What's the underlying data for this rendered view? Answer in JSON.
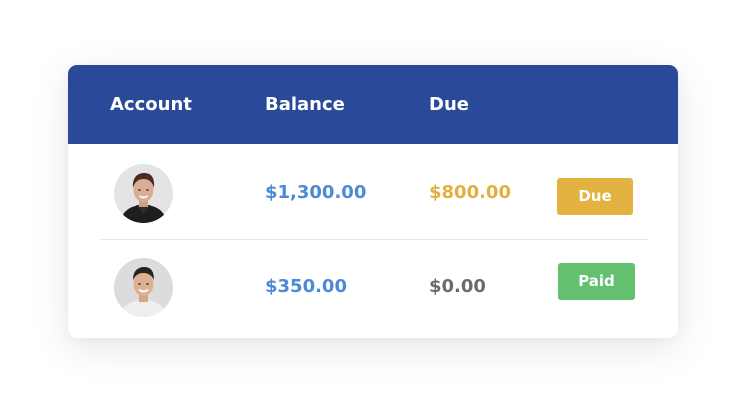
{
  "table": {
    "columns": {
      "account": "Account",
      "balance": "Balance",
      "due": "Due"
    },
    "rows": [
      {
        "balance": "$1,300.00",
        "due": "$800.00",
        "due_color": "#e3b040",
        "status": "Due",
        "status_color": "#e3b240"
      },
      {
        "balance": "$350.00",
        "due": "$0.00",
        "due_color": "#6b6b6b",
        "status": "Paid",
        "status_color": "#62c06f"
      }
    ]
  },
  "colors": {
    "header": "#2a4a99",
    "balance": "#4a8ad6"
  },
  "icons": {
    "row_avatar": "user-photo-avatar"
  }
}
